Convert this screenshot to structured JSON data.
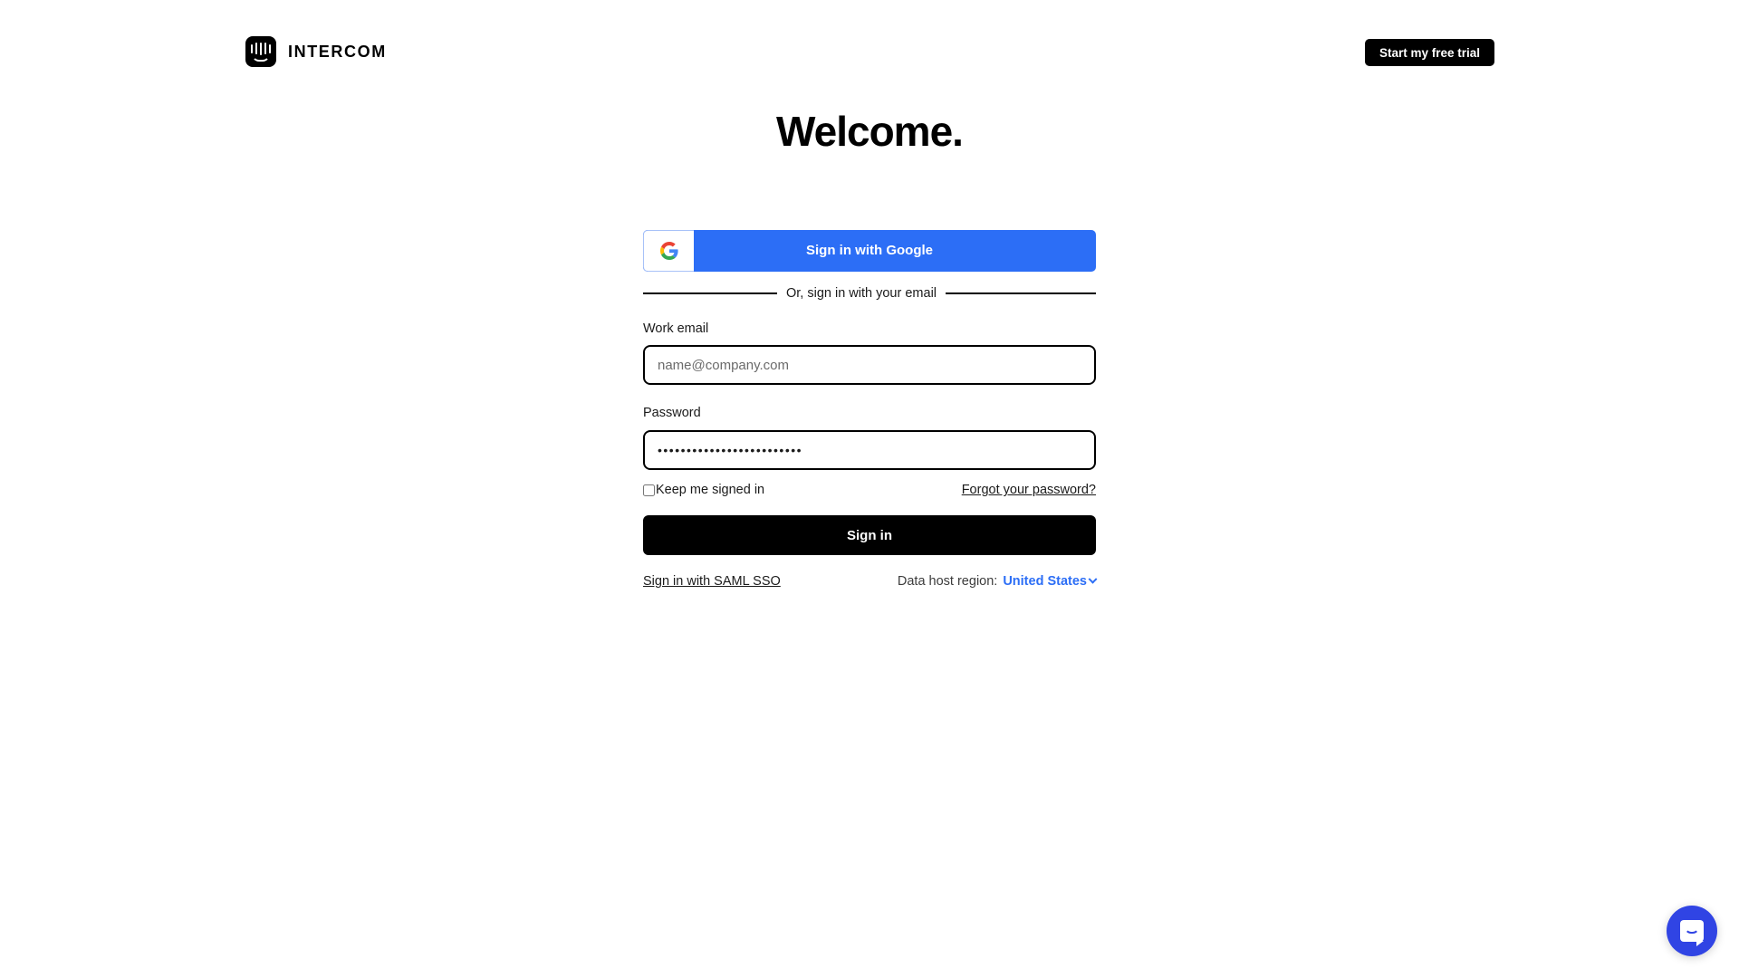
{
  "header": {
    "brand_name": "INTERCOM",
    "trial_button": "Start my free trial"
  },
  "main": {
    "heading": "Welcome.",
    "google_button": "Sign in with Google",
    "divider_text": "Or, sign in with your email",
    "email": {
      "label": "Work email",
      "placeholder": "name@company.com",
      "value": ""
    },
    "password": {
      "label": "Password",
      "placeholder": "",
      "value": "•••••••••••••••••••••••••"
    },
    "keep_signed_in": {
      "label": "Keep me signed in",
      "checked": false
    },
    "forgot_password": "Forgot your password?",
    "signin_button": "Sign in",
    "saml_link": "Sign in with SAML SSO",
    "data_host_region": {
      "label": "Data host region:",
      "value": "United States"
    }
  },
  "colors": {
    "google_blue": "#2c6ef6",
    "link_blue": "#2c6ef6",
    "launcher_blue": "#3044e4",
    "black": "#000000"
  }
}
